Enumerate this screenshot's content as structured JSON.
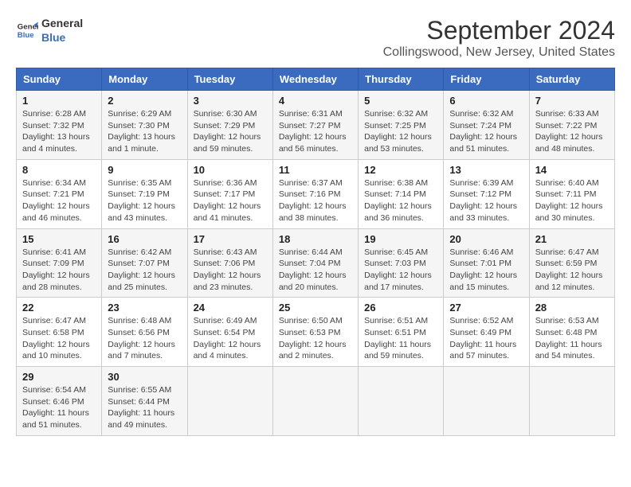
{
  "logo": {
    "line1": "General",
    "line2": "Blue"
  },
  "title": "September 2024",
  "subtitle": "Collingswood, New Jersey, United States",
  "days_of_week": [
    "Sunday",
    "Monday",
    "Tuesday",
    "Wednesday",
    "Thursday",
    "Friday",
    "Saturday"
  ],
  "weeks": [
    [
      {
        "day": 1,
        "info": "Sunrise: 6:28 AM\nSunset: 7:32 PM\nDaylight: 13 hours\nand 4 minutes."
      },
      {
        "day": 2,
        "info": "Sunrise: 6:29 AM\nSunset: 7:30 PM\nDaylight: 13 hours\nand 1 minute."
      },
      {
        "day": 3,
        "info": "Sunrise: 6:30 AM\nSunset: 7:29 PM\nDaylight: 12 hours\nand 59 minutes."
      },
      {
        "day": 4,
        "info": "Sunrise: 6:31 AM\nSunset: 7:27 PM\nDaylight: 12 hours\nand 56 minutes."
      },
      {
        "day": 5,
        "info": "Sunrise: 6:32 AM\nSunset: 7:25 PM\nDaylight: 12 hours\nand 53 minutes."
      },
      {
        "day": 6,
        "info": "Sunrise: 6:32 AM\nSunset: 7:24 PM\nDaylight: 12 hours\nand 51 minutes."
      },
      {
        "day": 7,
        "info": "Sunrise: 6:33 AM\nSunset: 7:22 PM\nDaylight: 12 hours\nand 48 minutes."
      }
    ],
    [
      {
        "day": 8,
        "info": "Sunrise: 6:34 AM\nSunset: 7:21 PM\nDaylight: 12 hours\nand 46 minutes."
      },
      {
        "day": 9,
        "info": "Sunrise: 6:35 AM\nSunset: 7:19 PM\nDaylight: 12 hours\nand 43 minutes."
      },
      {
        "day": 10,
        "info": "Sunrise: 6:36 AM\nSunset: 7:17 PM\nDaylight: 12 hours\nand 41 minutes."
      },
      {
        "day": 11,
        "info": "Sunrise: 6:37 AM\nSunset: 7:16 PM\nDaylight: 12 hours\nand 38 minutes."
      },
      {
        "day": 12,
        "info": "Sunrise: 6:38 AM\nSunset: 7:14 PM\nDaylight: 12 hours\nand 36 minutes."
      },
      {
        "day": 13,
        "info": "Sunrise: 6:39 AM\nSunset: 7:12 PM\nDaylight: 12 hours\nand 33 minutes."
      },
      {
        "day": 14,
        "info": "Sunrise: 6:40 AM\nSunset: 7:11 PM\nDaylight: 12 hours\nand 30 minutes."
      }
    ],
    [
      {
        "day": 15,
        "info": "Sunrise: 6:41 AM\nSunset: 7:09 PM\nDaylight: 12 hours\nand 28 minutes."
      },
      {
        "day": 16,
        "info": "Sunrise: 6:42 AM\nSunset: 7:07 PM\nDaylight: 12 hours\nand 25 minutes."
      },
      {
        "day": 17,
        "info": "Sunrise: 6:43 AM\nSunset: 7:06 PM\nDaylight: 12 hours\nand 23 minutes."
      },
      {
        "day": 18,
        "info": "Sunrise: 6:44 AM\nSunset: 7:04 PM\nDaylight: 12 hours\nand 20 minutes."
      },
      {
        "day": 19,
        "info": "Sunrise: 6:45 AM\nSunset: 7:03 PM\nDaylight: 12 hours\nand 17 minutes."
      },
      {
        "day": 20,
        "info": "Sunrise: 6:46 AM\nSunset: 7:01 PM\nDaylight: 12 hours\nand 15 minutes."
      },
      {
        "day": 21,
        "info": "Sunrise: 6:47 AM\nSunset: 6:59 PM\nDaylight: 12 hours\nand 12 minutes."
      }
    ],
    [
      {
        "day": 22,
        "info": "Sunrise: 6:47 AM\nSunset: 6:58 PM\nDaylight: 12 hours\nand 10 minutes."
      },
      {
        "day": 23,
        "info": "Sunrise: 6:48 AM\nSunset: 6:56 PM\nDaylight: 12 hours\nand 7 minutes."
      },
      {
        "day": 24,
        "info": "Sunrise: 6:49 AM\nSunset: 6:54 PM\nDaylight: 12 hours\nand 4 minutes."
      },
      {
        "day": 25,
        "info": "Sunrise: 6:50 AM\nSunset: 6:53 PM\nDaylight: 12 hours\nand 2 minutes."
      },
      {
        "day": 26,
        "info": "Sunrise: 6:51 AM\nSunset: 6:51 PM\nDaylight: 11 hours\nand 59 minutes."
      },
      {
        "day": 27,
        "info": "Sunrise: 6:52 AM\nSunset: 6:49 PM\nDaylight: 11 hours\nand 57 minutes."
      },
      {
        "day": 28,
        "info": "Sunrise: 6:53 AM\nSunset: 6:48 PM\nDaylight: 11 hours\nand 54 minutes."
      }
    ],
    [
      {
        "day": 29,
        "info": "Sunrise: 6:54 AM\nSunset: 6:46 PM\nDaylight: 11 hours\nand 51 minutes."
      },
      {
        "day": 30,
        "info": "Sunrise: 6:55 AM\nSunset: 6:44 PM\nDaylight: 11 hours\nand 49 minutes."
      },
      null,
      null,
      null,
      null,
      null
    ]
  ]
}
